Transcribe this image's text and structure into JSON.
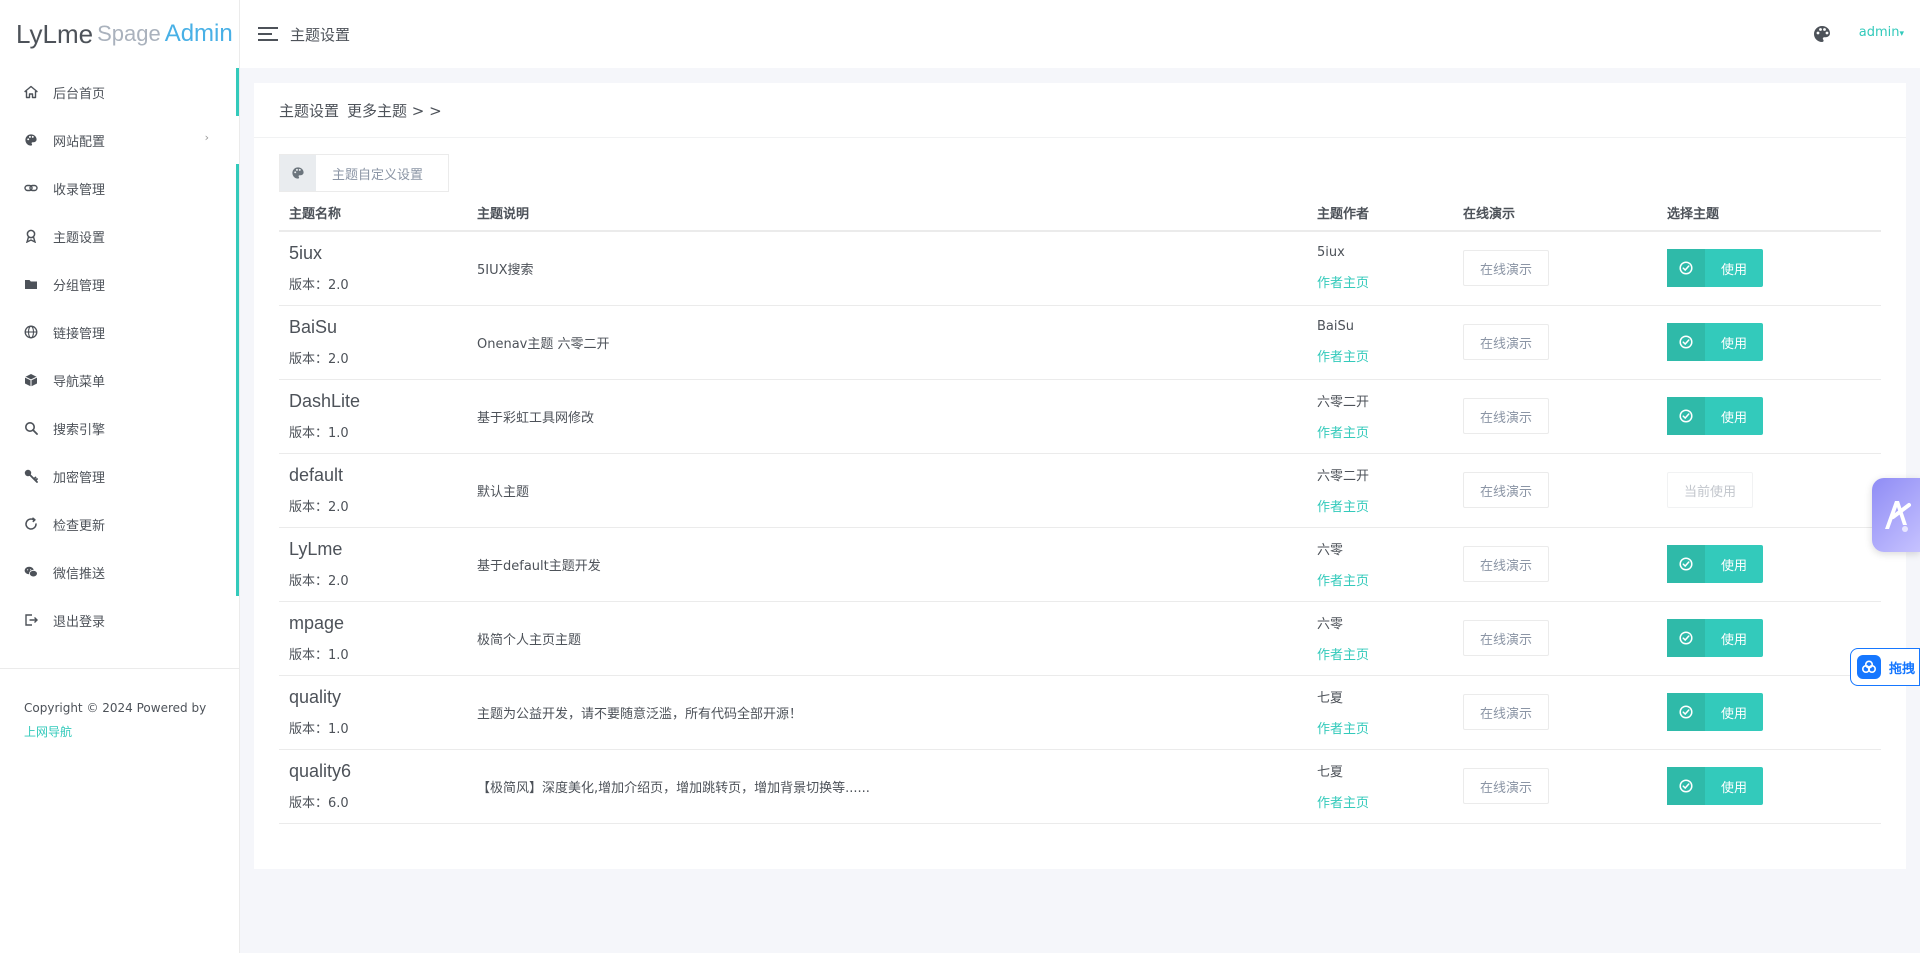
{
  "logo": {
    "part1": "LyLme",
    "part2": "Spage",
    "part3": "Admin"
  },
  "sidebar": {
    "items": [
      {
        "label": "后台首页",
        "icon": "home-icon"
      },
      {
        "label": "网站配置",
        "icon": "palette-icon",
        "chevron": "›"
      },
      {
        "label": "收录管理",
        "icon": "link-icon"
      },
      {
        "label": "主题设置",
        "icon": "award-icon"
      },
      {
        "label": "分组管理",
        "icon": "folder-icon"
      },
      {
        "label": "链接管理",
        "icon": "globe-icon"
      },
      {
        "label": "导航菜单",
        "icon": "cube-icon"
      },
      {
        "label": "搜索引擎",
        "icon": "search-icon"
      },
      {
        "label": "加密管理",
        "icon": "key-icon"
      },
      {
        "label": "检查更新",
        "icon": "refresh-icon"
      },
      {
        "label": "微信推送",
        "icon": "wechat-icon"
      },
      {
        "label": "退出登录",
        "icon": "logout-icon"
      }
    ],
    "copyright_text": "Copyright © 2024 Powered by",
    "copyright_link": "上网导航"
  },
  "header": {
    "title": "主题设置",
    "user": "admin"
  },
  "card": {
    "title": "主题设置",
    "more_link": "更多主题 > >",
    "custom_button": "主题自定义设置"
  },
  "table": {
    "headers": [
      "主题名称",
      "主题说明",
      "主题作者",
      "在线演示",
      "选择主题"
    ],
    "rows": [
      {
        "name": "5iux",
        "version": "版本：2.0",
        "desc": "5IUX搜索",
        "author": "5iux",
        "author_link": "作者主页",
        "demo": "在线演示",
        "action": "使用",
        "current": false
      },
      {
        "name": "BaiSu",
        "version": "版本：2.0",
        "desc": "Onenav主题 六零二开",
        "author": "BaiSu",
        "author_link": "作者主页",
        "demo": "在线演示",
        "action": "使用",
        "current": false
      },
      {
        "name": "DashLite",
        "version": "版本：1.0",
        "desc": "基于彩虹工具网修改",
        "author": "六零二开",
        "author_link": "作者主页",
        "demo": "在线演示",
        "action": "使用",
        "current": false
      },
      {
        "name": "default",
        "version": "版本：2.0",
        "desc": "默认主题",
        "author": "六零二开",
        "author_link": "作者主页",
        "demo": "在线演示",
        "action": "当前使用",
        "current": true
      },
      {
        "name": "LyLme",
        "version": "版本：2.0",
        "desc": "基于default主题开发",
        "author": "六零",
        "author_link": "作者主页",
        "demo": "在线演示",
        "action": "使用",
        "current": false
      },
      {
        "name": "mpage",
        "version": "版本：1.0",
        "desc": "极简个人主页主题",
        "author": "六零",
        "author_link": "作者主页",
        "demo": "在线演示",
        "action": "使用",
        "current": false
      },
      {
        "name": "quality",
        "version": "版本：1.0",
        "desc": "主题为公益开发，请不要随意泛滥，所有代码全部开源！",
        "author": "七夏",
        "author_link": "作者主页",
        "demo": "在线演示",
        "action": "使用",
        "current": false
      },
      {
        "name": "quality6",
        "version": "版本：6.0",
        "desc": "【极简风】深度美化,增加介绍页，增加跳转页，增加背景切换等......",
        "author": "七夏",
        "author_link": "作者主页",
        "demo": "在线演示",
        "action": "使用",
        "current": false
      }
    ]
  },
  "float_drag": {
    "label": "拖拽"
  },
  "colors": {
    "accent": "#33cabb",
    "accent_dark": "#2fbaa9",
    "logo_admin": "#48b0e6"
  }
}
